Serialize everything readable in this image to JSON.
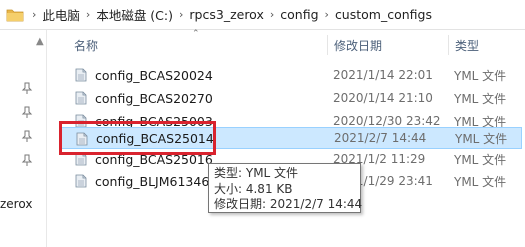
{
  "address": {
    "crumbs": [
      "此电脑",
      "本地磁盘 (C:)",
      "rpcs3_zerox",
      "config",
      "custom_configs"
    ]
  },
  "nav": {
    "partial_item": "zerox"
  },
  "columns": {
    "name": "名称",
    "date": "修改日期",
    "type": "类型"
  },
  "files": [
    {
      "name": "config_BCAS20024",
      "date": "2021/1/14 22:01",
      "type": "YML 文件"
    },
    {
      "name": "config_BCAS20270",
      "date": "2020/1/14 21:10",
      "type": "YML 文件"
    },
    {
      "name": "config_BCAS25003",
      "date": "2020/12/30 23:42",
      "type": "YML 文件"
    },
    {
      "name": "config_BCAS25014",
      "date": "2021/2/7 14:44",
      "type": "YML 文件"
    },
    {
      "name": "config_BCAS25016",
      "date": "2021/1/2 11:29",
      "type": "YML 文件"
    },
    {
      "name": "config_BLJM61346",
      "date": "2021/1/29 23:41",
      "type": "YML 文件"
    }
  ],
  "selected_index": 3,
  "tooltip": {
    "type_line": "类型: YML 文件",
    "size_line": "大小: 4.81 KB",
    "date_line": "修改日期: 2021/2/7 14:44"
  },
  "colors": {
    "selection": "#cce8ff",
    "highlight_box": "#d9232e",
    "header_text": "#4c607a"
  }
}
